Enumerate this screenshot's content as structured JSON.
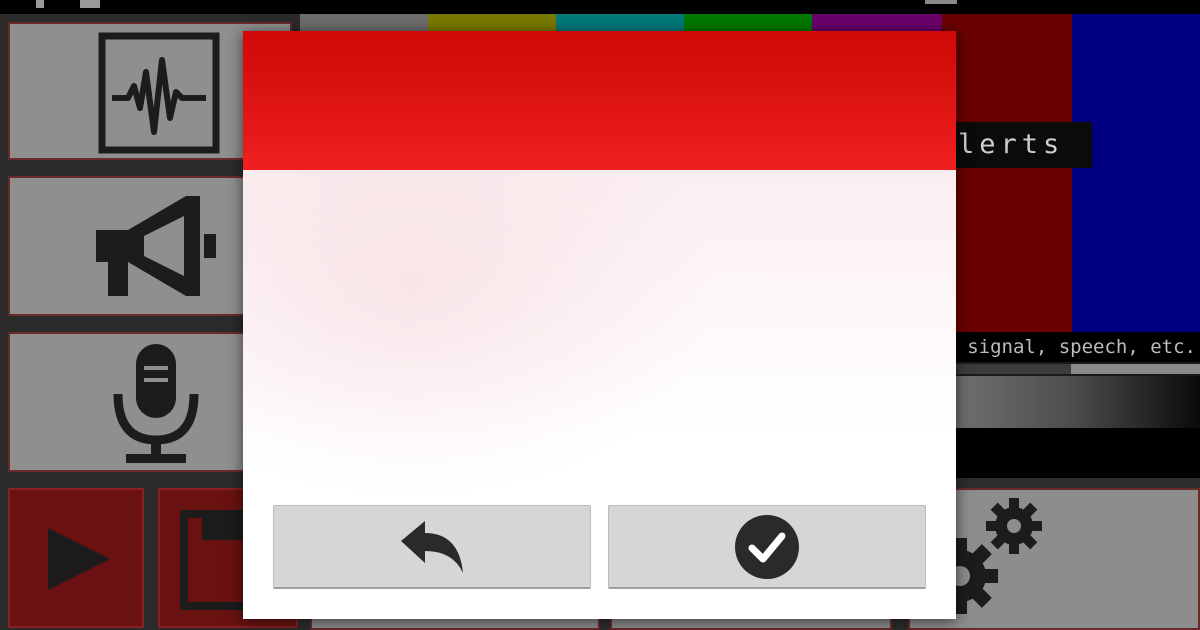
{
  "app": {
    "alerts_label": "lerts",
    "caption_text": "signal, speech, etc.",
    "progress_fraction": 0.47,
    "color_bars": [
      "#6e6e6e",
      "#7a7a00",
      "#007a7a",
      "#007a00",
      "#7a007a",
      "#7a0000",
      "#00007a"
    ]
  },
  "dialog": {
    "header_color": "#e01414",
    "back_button": {
      "icon": "undo-arrow-icon"
    },
    "confirm_button": {
      "icon": "check-circle-icon"
    }
  },
  "icons": {
    "waveform": "waveform-icon",
    "megaphone": "megaphone-icon",
    "microphone": "microphone-icon",
    "play": "play-icon",
    "save": "floppy-disk-icon",
    "settings": "gears-icon"
  }
}
